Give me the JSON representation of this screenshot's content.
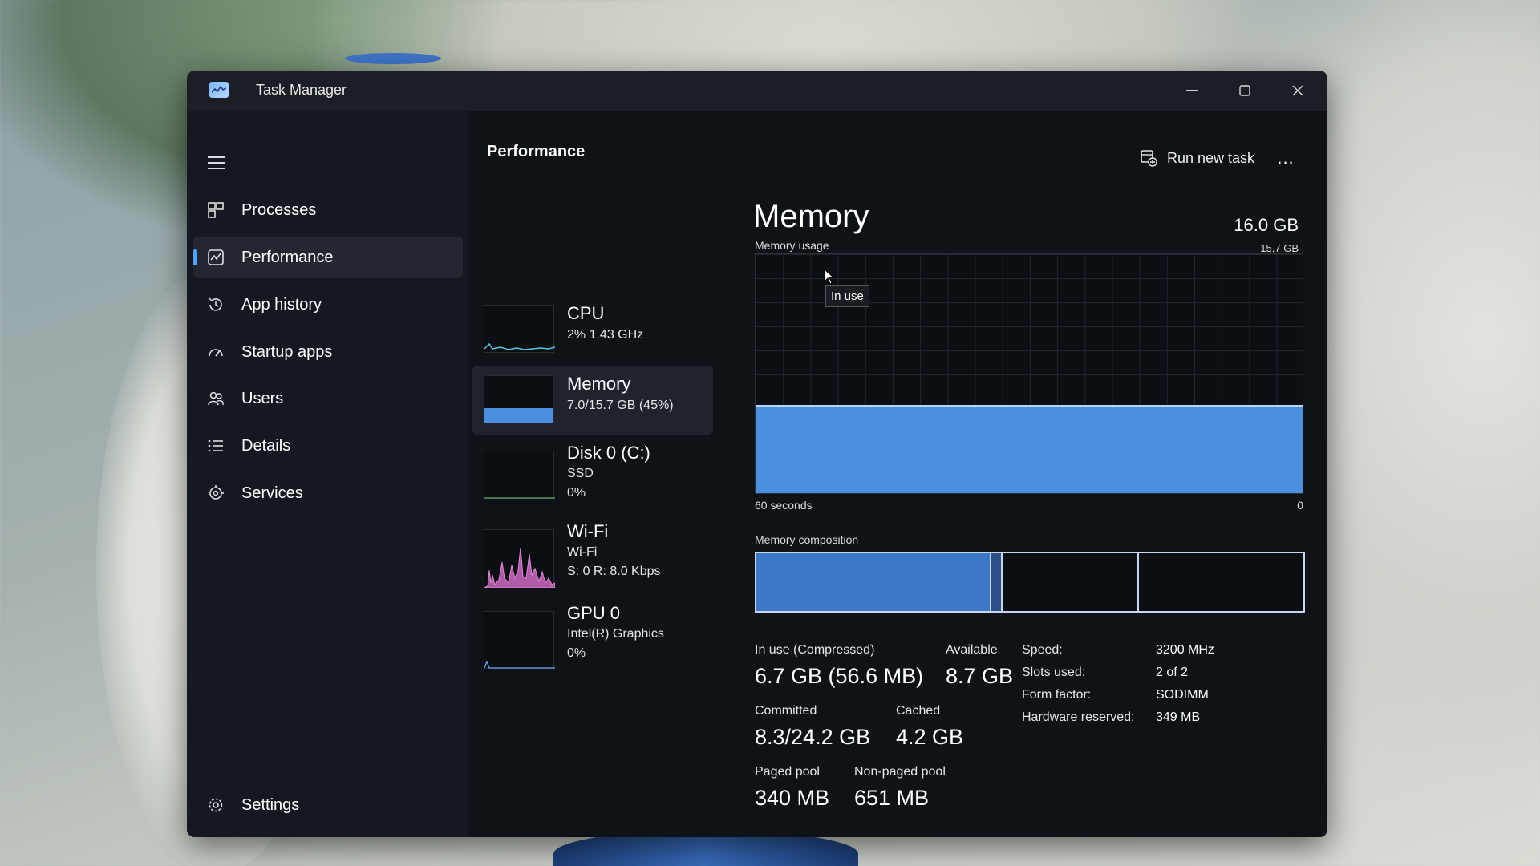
{
  "window": {
    "title": "Task Manager"
  },
  "sidebar": {
    "items": [
      {
        "label": "Processes",
        "icon": "processes-icon"
      },
      {
        "label": "Performance",
        "icon": "performance-icon",
        "active": true
      },
      {
        "label": "App history",
        "icon": "app-history-icon"
      },
      {
        "label": "Startup apps",
        "icon": "startup-apps-icon"
      },
      {
        "label": "Users",
        "icon": "users-icon"
      },
      {
        "label": "Details",
        "icon": "details-icon"
      },
      {
        "label": "Services",
        "icon": "services-icon"
      }
    ],
    "settings_label": "Settings"
  },
  "header": {
    "title": "Performance",
    "run_new_task": "Run new task",
    "more": "..."
  },
  "devices": [
    {
      "name": "CPU",
      "line1": "2%  1.43 GHz",
      "line2": ""
    },
    {
      "name": "Memory",
      "line1": "7.0/15.7 GB (45%)",
      "line2": "",
      "usage_fraction": 0.45
    },
    {
      "name": "Disk 0 (C:)",
      "line1": "SSD",
      "line2": "0%"
    },
    {
      "name": "Wi-Fi",
      "line1": "Wi-Fi",
      "line2": "S: 0 R: 8.0 Kbps"
    },
    {
      "name": "GPU 0",
      "line1": "Intel(R) Graphics",
      "line2": "0%"
    }
  ],
  "memory": {
    "title": "Memory",
    "total": "16.0 GB",
    "usage_label": "Memory usage",
    "usage_max": "15.7 GB",
    "usage_fraction": 0.37,
    "time_label": "60 seconds",
    "time_end": "0",
    "tooltip": "In use",
    "composition_label": "Memory composition",
    "composition": {
      "in_use_fraction": 0.43,
      "modified_fraction": 0.02,
      "standby_fraction": 0.25
    },
    "stats": {
      "in_use_label": "In use (Compressed)",
      "in_use_value": "6.7 GB (56.6 MB)",
      "available_label": "Available",
      "available_value": "8.7 GB",
      "committed_label": "Committed",
      "committed_value": "8.3/24.2 GB",
      "cached_label": "Cached",
      "cached_value": "4.2 GB",
      "paged_label": "Paged pool",
      "paged_value": "340 MB",
      "nonpaged_label": "Non-paged pool",
      "nonpaged_value": "651 MB"
    },
    "hardware": {
      "speed_label": "Speed:",
      "speed_value": "3200 MHz",
      "slots_label": "Slots used:",
      "slots_value": "2 of 2",
      "form_label": "Form factor:",
      "form_value": "SODIMM",
      "reserved_label": "Hardware reserved:",
      "reserved_value": "349 MB"
    }
  },
  "colors": {
    "accent": "#4fa3ff",
    "memory_fill": "#4a8fe0",
    "wifi_line": "#e08ad8",
    "cpu_line": "#55c7d8"
  }
}
